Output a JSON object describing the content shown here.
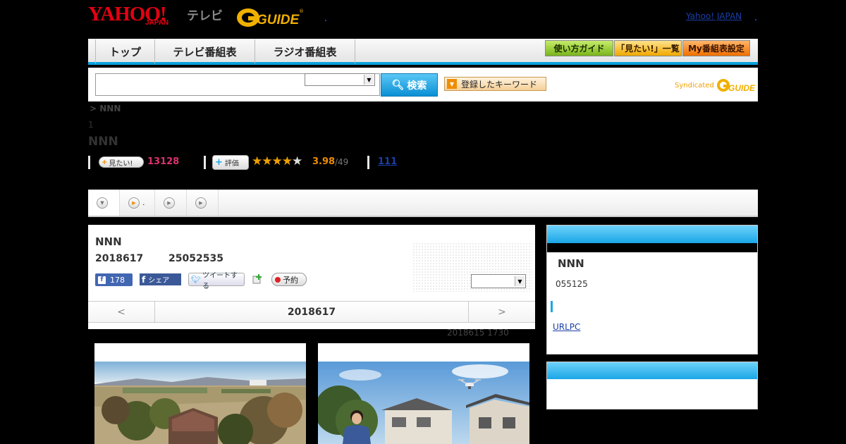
{
  "header": {
    "logo_yahoo": "YAHOO!",
    "logo_japan": "JAPAN",
    "logo_tv": "テレビ",
    "logo_gguide": "G-GUIDE",
    "yahoo_japan_link": "Yahoo! JAPAN"
  },
  "nav": {
    "tabs": [
      {
        "label": "トップ"
      },
      {
        "label": "テレビ番組表"
      },
      {
        "label": "ラジオ番組表"
      }
    ],
    "guide_label": "使い方ガイド",
    "mitai_label": "「見たい!」一覧",
    "my_label": "My番組表設定"
  },
  "search": {
    "input_value": "",
    "select_value": "",
    "button_label": "検索",
    "keyword_label": "登録したキーワード",
    "syndicated": "Syndicated"
  },
  "program": {
    "breadcrumb": "> NNN",
    "episode": "1",
    "title": "NNN",
    "mitai_badge": "見たい!",
    "mitai_count": "13128",
    "rate_badge": "評価",
    "stars_full": "★★★★",
    "stars_empty": "★",
    "rating": "3.98",
    "rating_count": "/49",
    "review_count": "111"
  },
  "tabs": [
    {
      "label": ""
    },
    {
      "label": "."
    },
    {
      "label": ""
    },
    {
      "label": ""
    }
  ],
  "detail": {
    "title": "NNN",
    "date": "2018617",
    "time": "25052535",
    "fb_count": "178",
    "fb_share": "シェア",
    "tweet": "ツイートする",
    "reserve": "予約",
    "prev": "<",
    "day_label": "2018617",
    "next": ">",
    "updated": "2018615  1730"
  },
  "sidebar": {
    "title": "NNN",
    "time": "055125",
    "url_label": "URLPC"
  },
  "colors": {
    "accent_blue": "#1aa6e6",
    "yahoo_red": "#e60012",
    "mitai_pink": "#e03070",
    "rating_orange": "#f08c00"
  }
}
